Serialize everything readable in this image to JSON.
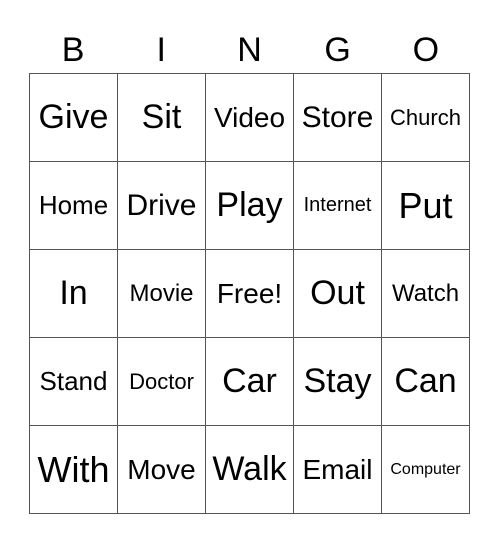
{
  "header": [
    "B",
    "I",
    "N",
    "G",
    "O"
  ],
  "cells": [
    [
      "Give",
      "Sit",
      "Video",
      "Store",
      "Church"
    ],
    [
      "Home",
      "Drive",
      "Play",
      "Internet",
      "Put"
    ],
    [
      "In",
      "Movie",
      "Free!",
      "Out",
      "Watch"
    ],
    [
      "Stand",
      "Doctor",
      "Car",
      "Stay",
      "Can"
    ],
    [
      "With",
      "Move",
      "Walk",
      "Email",
      "Computer"
    ]
  ]
}
